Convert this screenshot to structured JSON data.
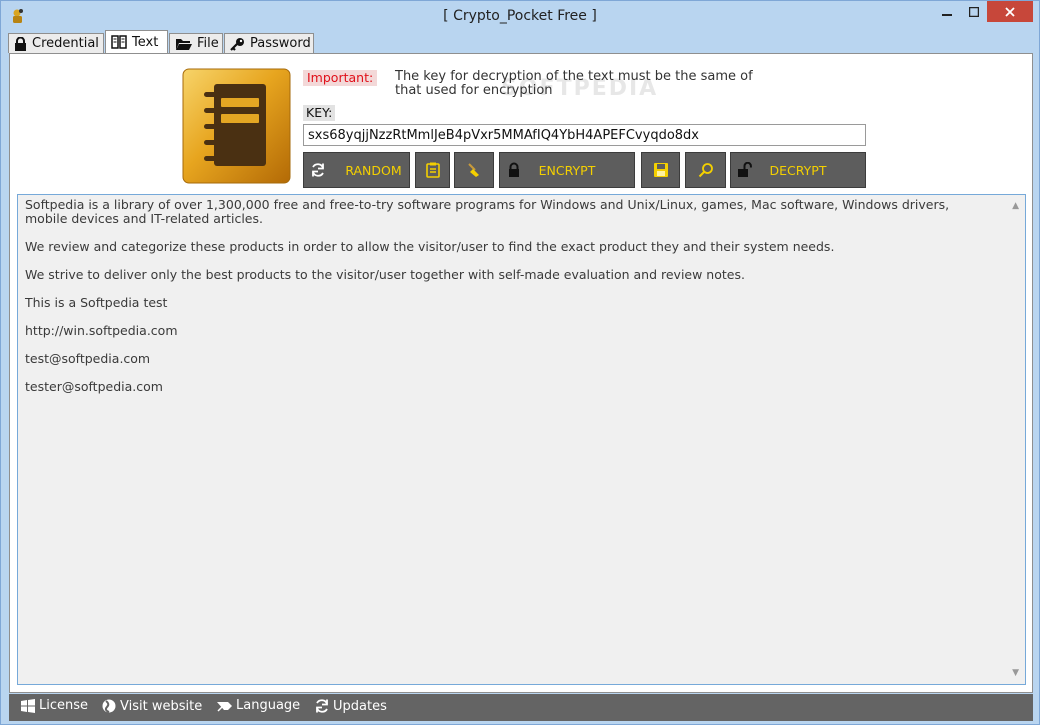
{
  "window": {
    "title": "[ Crypto_Pocket Free ]"
  },
  "tabs": [
    {
      "label": "Credential",
      "icon": "lock-icon"
    },
    {
      "label": "Text",
      "icon": "book-icon",
      "active": true
    },
    {
      "label": "File",
      "icon": "folder-icon"
    },
    {
      "label": "Password",
      "icon": "key-icon"
    }
  ],
  "notice": {
    "important_label": "Important:",
    "important_text": "The key for decryption of the text must be the same of that used for encryption",
    "watermark": "SOFTPEDIA"
  },
  "key": {
    "label": "KEY:",
    "value": "sxs68yqjjNzzRtMmlJeB4pVxr5MMAfIQ4YbH4APEFCvyqdo8dx"
  },
  "toolbar": {
    "random_label": "RANDOM",
    "encrypt_label": "ENCRYPT",
    "decrypt_label": "DECRYPT"
  },
  "text_content": [
    "Softpedia is a library of over 1,300,000 free and free-to-try software programs for Windows and Unix/Linux, games, Mac software, Windows drivers, mobile devices and IT-related articles.",
    "We review and categorize these products in order to allow the visitor/user to find the exact product they and their system needs.",
    "We strive to deliver only the best products to the visitor/user together with self-made evaluation and review notes.",
    "This is a Softpedia test",
    "http://win.softpedia.com",
    "test@softpedia.com",
    "tester@softpedia.com"
  ],
  "statusbar": {
    "license": "License",
    "visit_website": "Visit website",
    "language": "Language",
    "updates": "Updates"
  },
  "colors": {
    "accent": "#f4d000",
    "button_bg": "#5d5d5d",
    "important": "#e0101a"
  }
}
